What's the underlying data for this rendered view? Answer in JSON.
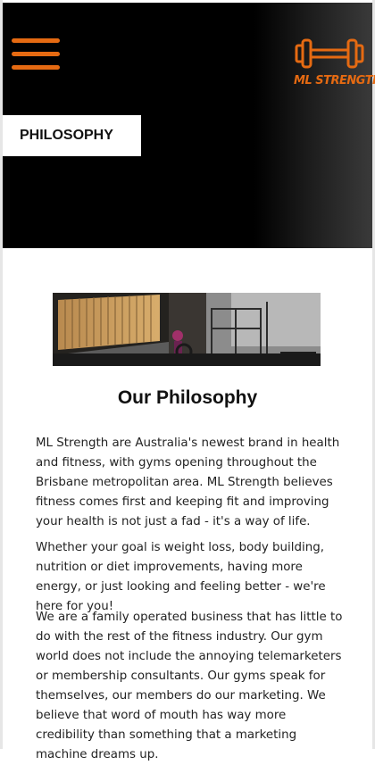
{
  "brand": {
    "logo_text": "ML STRENGTH",
    "accent_color": "#e56a12"
  },
  "header": {
    "menu_icon": "hamburger-menu-icon",
    "page_tag": "PHILOSOPHY"
  },
  "main": {
    "heading": "Our Philosophy",
    "paragraphs": [
      "ML Strength are Australia's newest brand in health and fitness, with gyms opening throughout the Brisbane metropolitan area. ML Strength believes fitness comes first and keeping fit and improving your health is not just a fad - it's a way of life.",
      "Whether your goal is weight loss, body building, nutrition or diet improvements, having more energy, or just looking and feeling better - we're here for you!",
      "We are a family operated business that has little to do with the rest of the fitness industry. Our gym world does not include the annoying telemarketers or membership consultants. Our gyms speak for themselves, our members do our marketing. We believe that word of mouth has way more credibility than something that a marketing machine dreams up."
    ]
  }
}
